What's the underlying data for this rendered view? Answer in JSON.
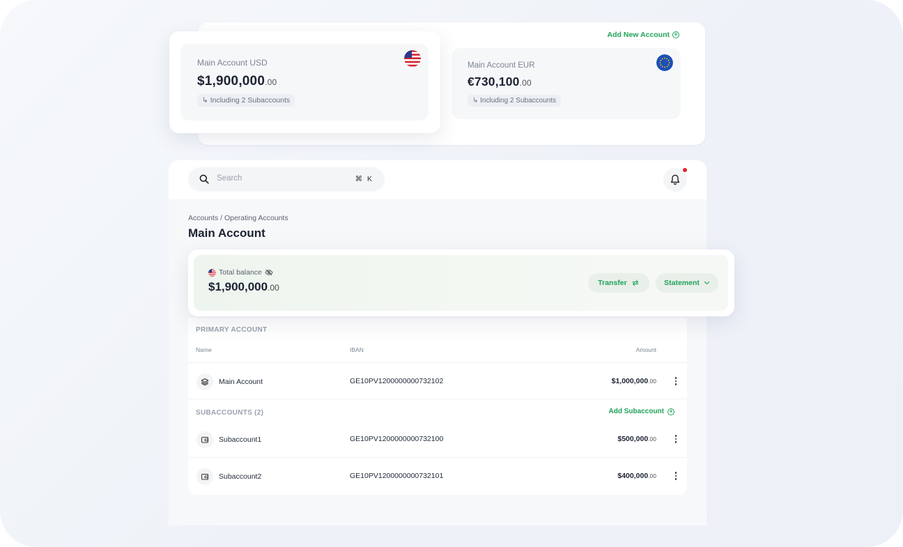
{
  "accounts_panel": {
    "add_new_label": "Add New Account",
    "cards": [
      {
        "label": "Main Account USD",
        "amount_main": "$1,900,000",
        "amount_cents": ".00",
        "subaccounts": "↳ Including 2 Subaccounts",
        "flag": "us-flag-icon"
      },
      {
        "label": "Main Account EUR",
        "amount_main": "€730,100",
        "amount_cents": ".00",
        "subaccounts": "↳ Including 2 Subaccounts",
        "flag": "eu-flag-icon"
      }
    ]
  },
  "topbar": {
    "search_placeholder": "Search",
    "shortcut": "⌘ K",
    "notification_color": "#e0242c"
  },
  "page": {
    "breadcrumb": "Accounts / Operating Accounts",
    "title": "Main Account"
  },
  "balance": {
    "label": "Total balance",
    "amount_main": "$1,900,000",
    "amount_cents": ".00",
    "transfer_label": "Transfer",
    "statement_label": "Statement"
  },
  "table": {
    "primary_header": "PRIMARY ACCOUNT",
    "columns": {
      "name": "Name",
      "iban": "IBAN",
      "amount": "Amount"
    },
    "primary_rows": [
      {
        "name": "Main Account",
        "iban": "GE10PV1200000000732102",
        "amount_main": "$1,000,000",
        "amount_cents": ".00",
        "icon": "layers-icon"
      }
    ],
    "subaccounts_header": "SUBACCOUNTS (2)",
    "add_subaccount_label": "Add Subaccount",
    "sub_rows": [
      {
        "name": "Subaccount1",
        "iban": "GE10PV1200000000732100",
        "amount_main": "$500,000",
        "amount_cents": ".00",
        "icon": "wallet-icon"
      },
      {
        "name": "Subaccount2",
        "iban": "GE10PV1200000000732101",
        "amount_main": "$400,000",
        "amount_cents": ".00",
        "icon": "wallet-icon"
      }
    ]
  },
  "colors": {
    "accent": "#1fa35a",
    "text": "#1c2333"
  }
}
